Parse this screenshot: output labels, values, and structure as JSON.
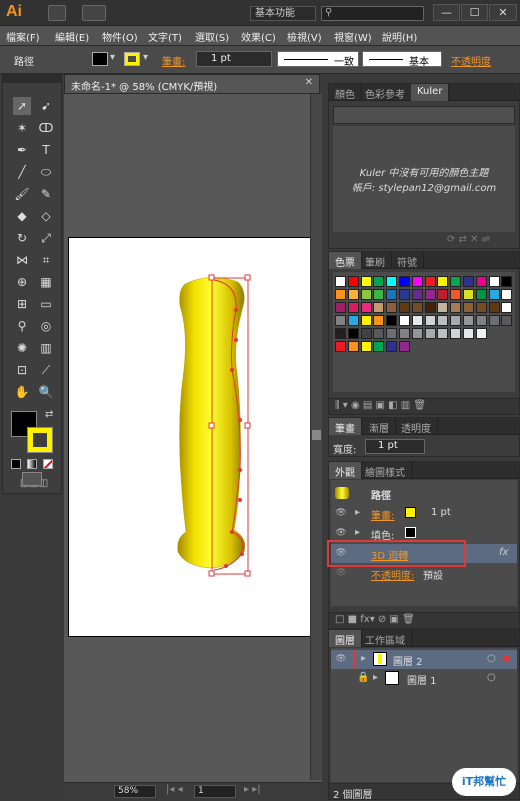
{
  "app": {
    "logo": "Ai",
    "workspace": "基本功能"
  },
  "window_buttons": [
    "—",
    "☐",
    "✕"
  ],
  "menus": [
    "檔案(F)",
    "編輯(E)",
    "物件(O)",
    "文字(T)",
    "選取(S)",
    "效果(C)",
    "檢視(V)",
    "視窗(W)",
    "說明(H)"
  ],
  "control": {
    "mode_label": "路徑",
    "stroke_label": "筆畫:",
    "stroke_value": "1 pt",
    "profile1": "一致",
    "profile2": "基本",
    "opacity_label": "不透明度"
  },
  "document": {
    "tab": "未命名-1* @ 58% (CMYK/預視)",
    "zoom": "58%",
    "page": "1"
  },
  "kuler": {
    "tabs": [
      "顏色",
      "色彩參考",
      "Kuler"
    ],
    "message1": "Kuler 中沒有可用的顏色主題",
    "message2": "帳戶: stylepan12@gmail.com"
  },
  "swatches": {
    "tabs": [
      "色票",
      "筆刷",
      "符號"
    ],
    "rows": [
      [
        "#ffffff",
        "#ff0000",
        "#ffff00",
        "#00a650",
        "#00ffff",
        "#0000ff",
        "#ff00ff",
        "#ed1c24",
        "#fff200",
        "#00a651",
        "#2e3192",
        "#ec008c",
        "#ffffff",
        "#000000"
      ],
      [
        "#f7941d",
        "#fbb040",
        "#8dc63f",
        "#39b54a",
        "#1b75bb",
        "#2b3990",
        "#662d91",
        "#92278f",
        "#be1e2d",
        "#f15a29",
        "#d7df23",
        "#009444",
        "#27aae1",
        "#ffffff"
      ],
      [
        "#9e1f63",
        "#da1c5c",
        "#ee2a7b",
        "#c49a6c",
        "#8b5e3c",
        "#603913",
        "#754c29",
        "#42210b",
        "#c2b59b",
        "#a67c52",
        "#8c6239",
        "#754c24",
        "#603813",
        "#ffffff"
      ],
      [
        "#808285",
        "#27aae1",
        "#fff200",
        "#f7941d",
        "#000000",
        "#ffffff",
        "#e6e7e8",
        "#d1d3d4",
        "#bcbec0",
        "#a7a9ac",
        "#939598",
        "#808285",
        "#6d6e71",
        "#58595b"
      ],
      [
        "#231f20",
        "#000000",
        "#414042",
        "#58595b",
        "#6d6e71",
        "#808285",
        "#939598",
        "#a7a9ac",
        "#bcbec0",
        "#d1d3d4",
        "#e6e7e8",
        "#f1f2f2"
      ],
      [
        "#ed1c24",
        "#f7941d",
        "#fff200",
        "#00a651",
        "#2e3192",
        "#92278f"
      ]
    ]
  },
  "stroke_panel": {
    "tabs": [
      "筆畫",
      "漸層",
      "透明度"
    ],
    "weight_label": "寬度:",
    "weight_value": "1 pt"
  },
  "appearance": {
    "tabs": [
      "外觀",
      "繪圖樣式"
    ],
    "path_label": "路徑",
    "stroke_label": "筆畫:",
    "stroke_value": "1 pt",
    "fill_label": "填色:",
    "effect": "3D 迴轉",
    "fx": "fx",
    "opacity_label": "不透明度:",
    "opacity_value": "預設"
  },
  "layers": {
    "tabs": [
      "圖層",
      "工作區域"
    ],
    "items": [
      "圖層 2",
      "圖層 1"
    ],
    "count": "2 個圖層"
  },
  "watermark": "iT邦幫忙"
}
